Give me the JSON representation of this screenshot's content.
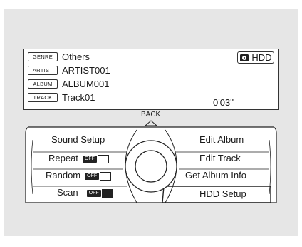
{
  "info": {
    "rows": [
      {
        "tag": "GENRE",
        "value": "Others"
      },
      {
        "tag": "ARTIST",
        "value": "ARTIST001"
      },
      {
        "tag": "ALBUM",
        "value": "ALBUM001"
      },
      {
        "tag": "TRACK",
        "value": "Track01"
      }
    ],
    "time": "0'03''",
    "source": "HDD"
  },
  "back_label": "BACK",
  "menu": {
    "left": [
      {
        "label": "Sound Setup"
      },
      {
        "label": "Repeat",
        "badge": "OFF"
      },
      {
        "label": "Random",
        "badge": "OFF"
      },
      {
        "label": "Scan",
        "badge": "OFF"
      }
    ],
    "right": [
      {
        "label": "Edit Album"
      },
      {
        "label": "Edit Track"
      },
      {
        "label": "Get Album Info"
      },
      {
        "label": "HDD Setup"
      }
    ]
  }
}
